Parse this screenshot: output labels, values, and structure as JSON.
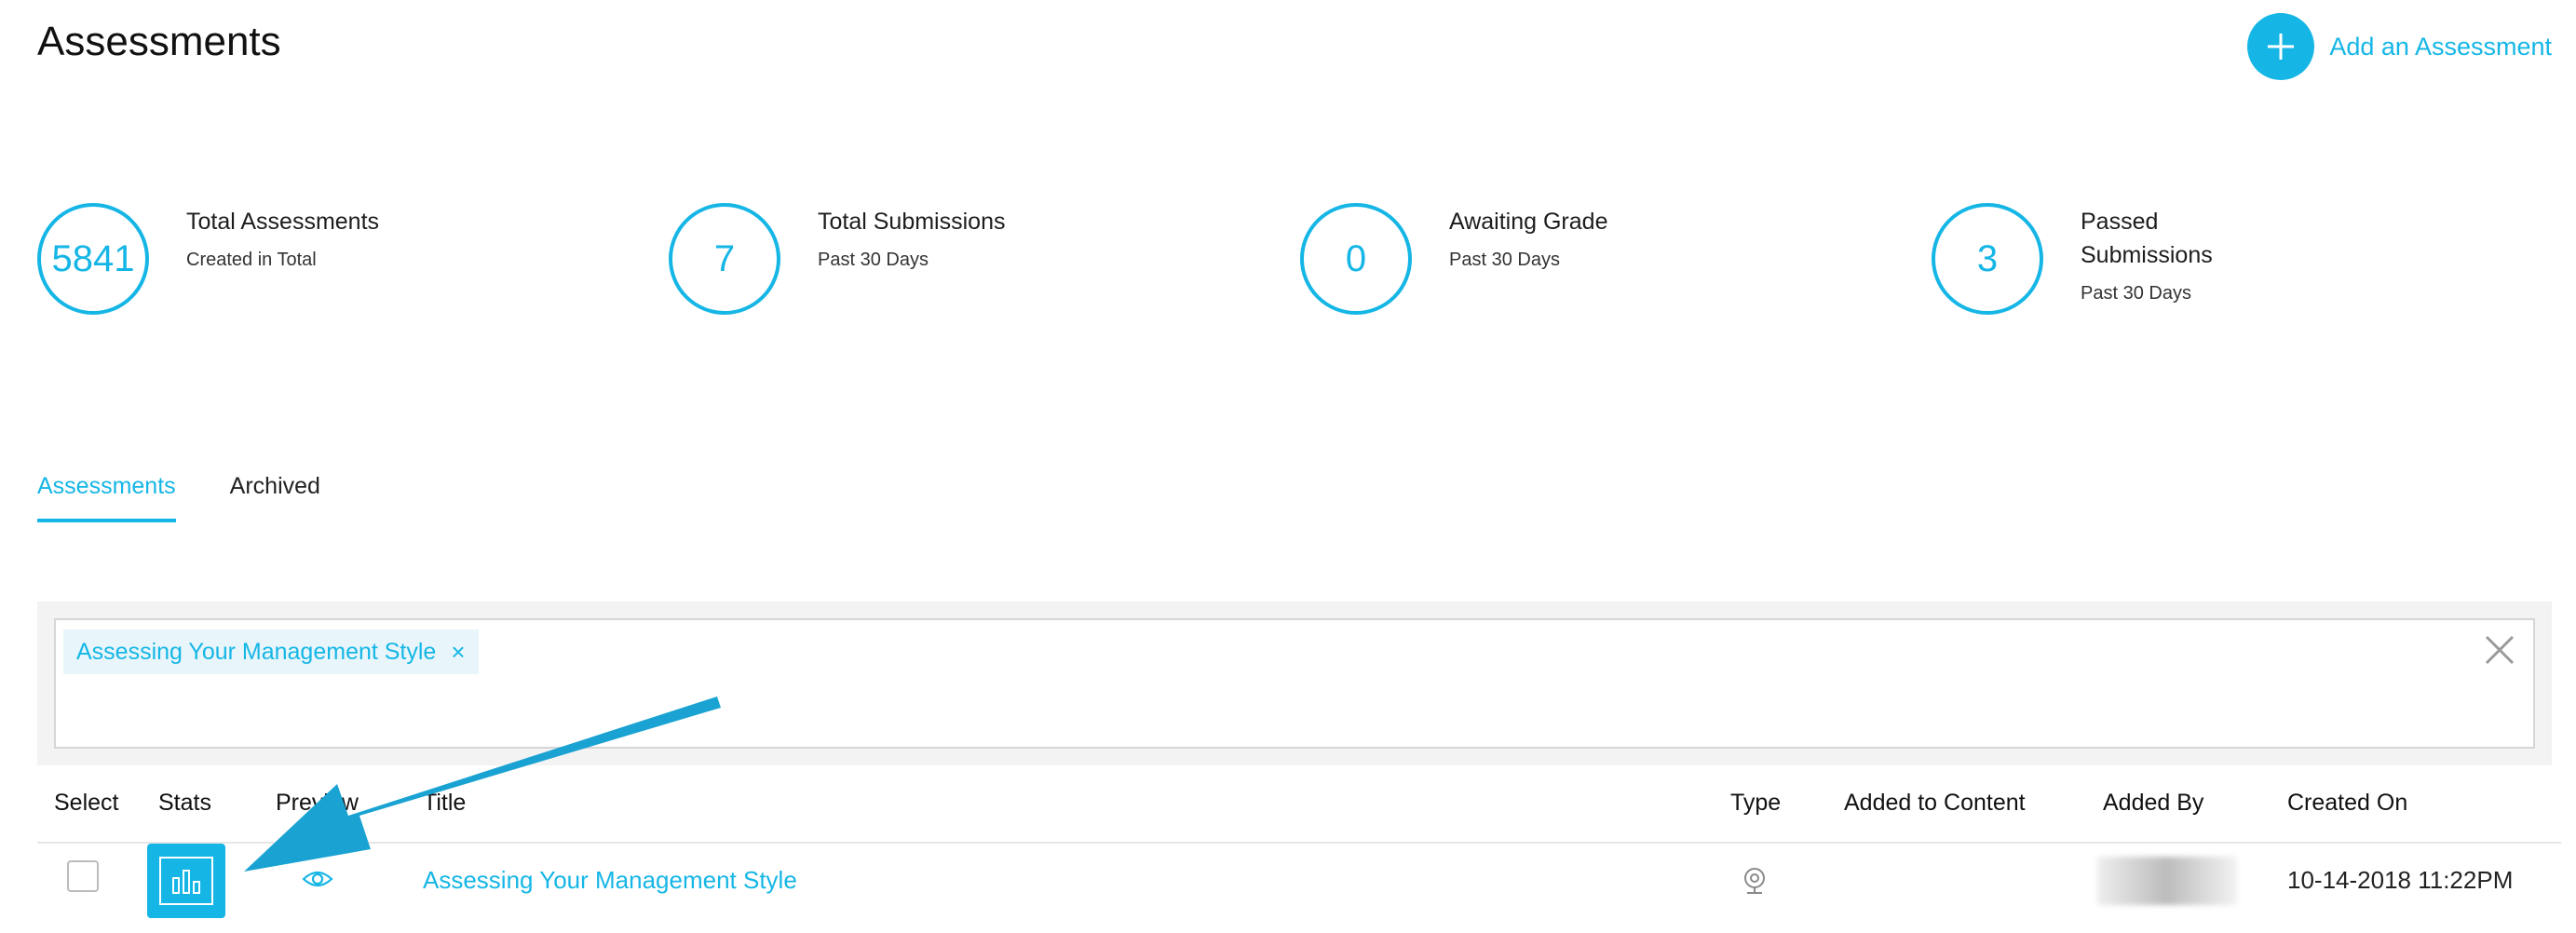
{
  "header": {
    "title": "Assessments",
    "add_label": "Add an Assessment",
    "add_icon": "plus-icon"
  },
  "stats": [
    {
      "value": "5841",
      "title": "Total Assessments",
      "subtitle": "Created in Total"
    },
    {
      "value": "7",
      "title": "Total Submissions",
      "subtitle": "Past 30 Days"
    },
    {
      "value": "0",
      "title": "Awaiting Grade",
      "subtitle": "Past 30 Days"
    },
    {
      "value": "3",
      "title": "Passed Submissions",
      "subtitle": "Past 30 Days"
    }
  ],
  "tabs": [
    {
      "label": "Assessments",
      "active": true
    },
    {
      "label": "Archived",
      "active": false
    }
  ],
  "filter": {
    "chip_label": "Assessing Your Management Style",
    "chip_remove": "×",
    "clear_icon": "close-icon"
  },
  "table": {
    "columns": [
      "Select",
      "Stats",
      "Preview",
      "Title",
      "Type",
      "Added to Content",
      "Added By",
      "Created On"
    ],
    "rows": [
      {
        "title": "Assessing Your Management Style",
        "type_icon": "webcam-icon",
        "added_to_content": "",
        "added_by": "",
        "created_on": "10-14-2018 11:22PM"
      }
    ]
  },
  "colors": {
    "accent": "#15b6e6",
    "arrow": "#1aa3d2"
  }
}
